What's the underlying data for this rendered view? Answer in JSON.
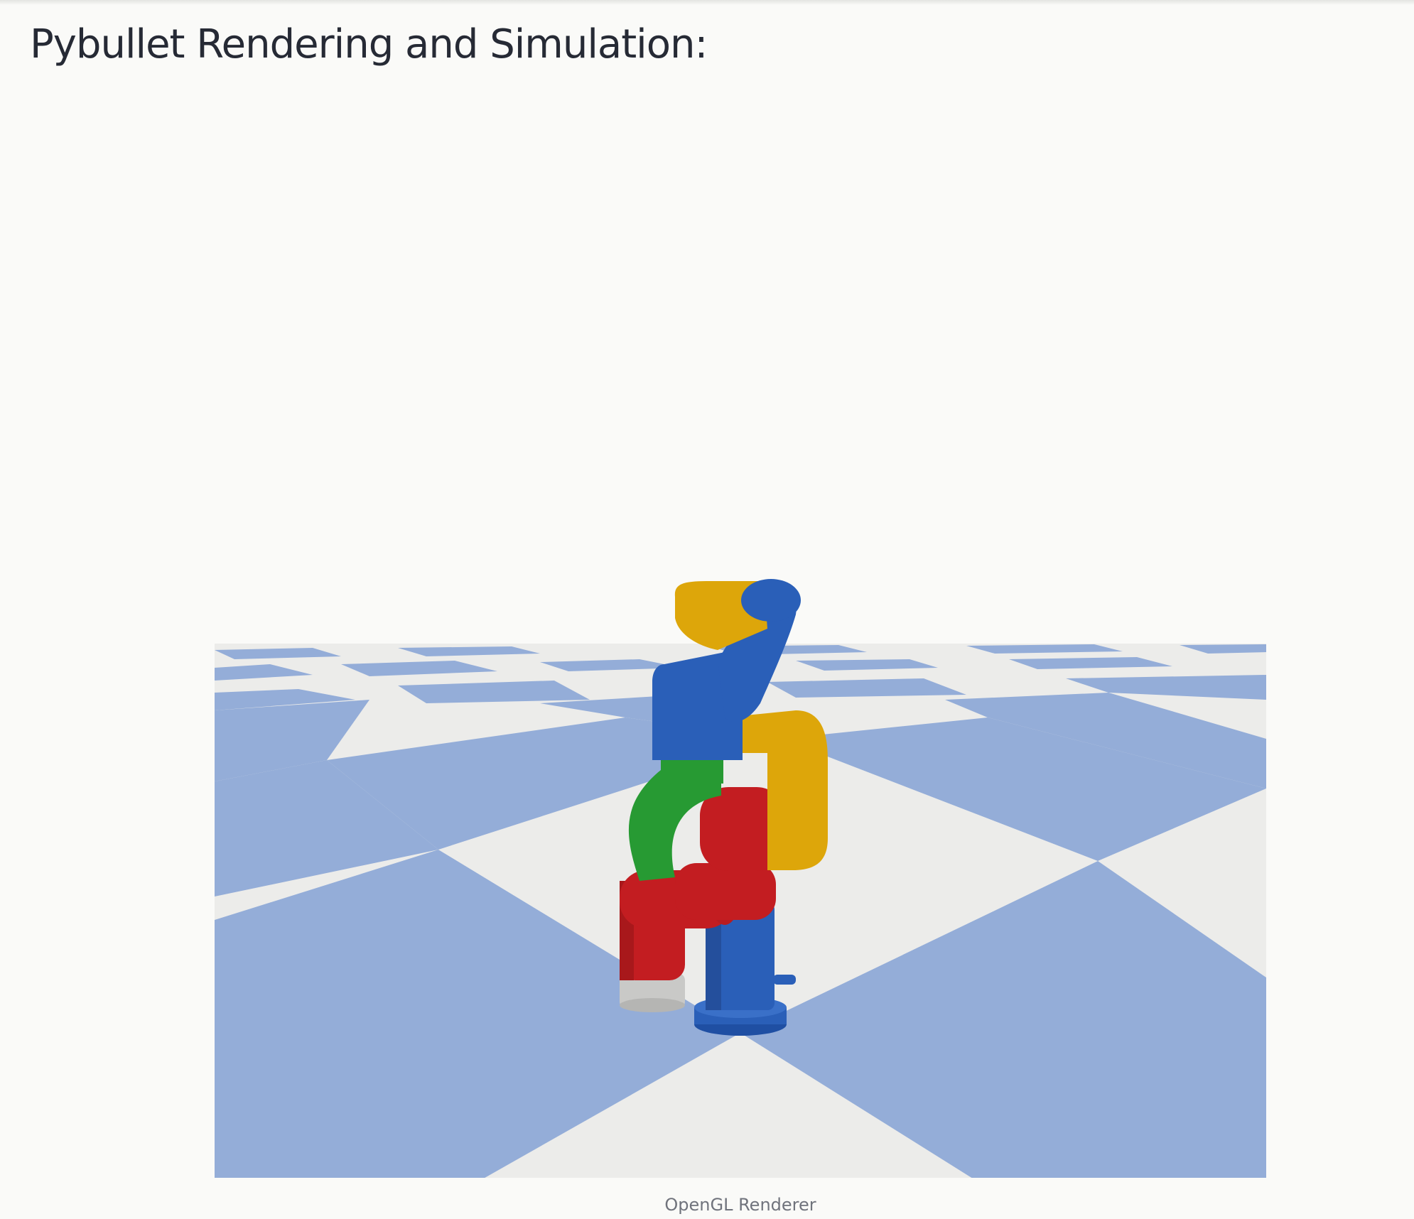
{
  "page": {
    "title": "Pybullet Rendering and Simulation:"
  },
  "viewer": {
    "caption": "OpenGL Renderer"
  },
  "colors": {
    "background": "#fafaf8",
    "floor_blue": "#94add8",
    "floor_white": "#ececea",
    "robot_blue": "#2a5fb8",
    "robot_yellow": "#dda60a",
    "robot_green": "#279a33",
    "robot_red": "#c31d21",
    "robot_gray": "#c9c9c7"
  }
}
